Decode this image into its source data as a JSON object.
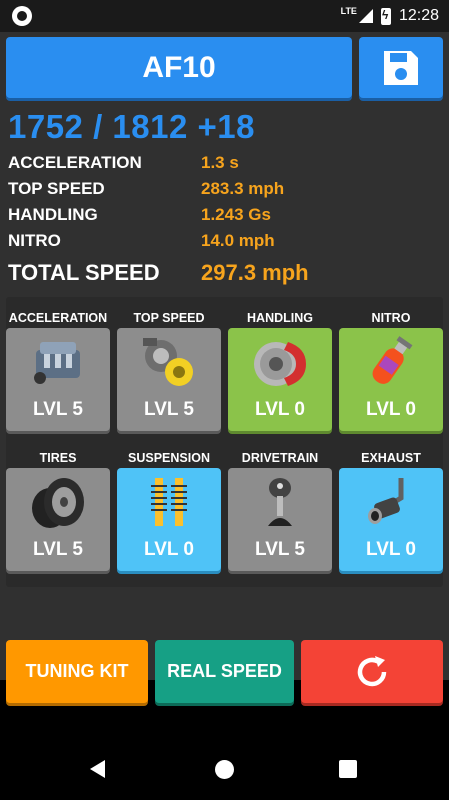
{
  "status_bar": {
    "network": "LTE",
    "time": "12:28"
  },
  "header": {
    "car_name": "AF10",
    "save_icon": "floppy-disk-icon"
  },
  "score": "1752 / 1812 +18",
  "stats": [
    {
      "label": "ACCELERATION",
      "value": "1.3 s"
    },
    {
      "label": "TOP SPEED",
      "value": "283.3 mph"
    },
    {
      "label": "HANDLING",
      "value": "1.243 Gs"
    },
    {
      "label": "NITRO",
      "value": "14.0 mph"
    }
  ],
  "total": {
    "label": "TOTAL SPEED",
    "value": "297.3 mph"
  },
  "upgrades": [
    {
      "label": "ACCELERATION",
      "level": "LVL 5",
      "color": "gray",
      "icon": "engine-icon"
    },
    {
      "label": "TOP SPEED",
      "level": "LVL 5",
      "color": "gray",
      "icon": "turbo-icon"
    },
    {
      "label": "HANDLING",
      "level": "LVL 0",
      "color": "green",
      "icon": "brake-disc-icon"
    },
    {
      "label": "NITRO",
      "level": "LVL 0",
      "color": "green",
      "icon": "nitro-bottle-icon"
    },
    {
      "label": "TIRES",
      "level": "LVL 5",
      "color": "gray",
      "icon": "tires-icon"
    },
    {
      "label": "SUSPENSION",
      "level": "LVL 0",
      "color": "blue",
      "icon": "suspension-icon"
    },
    {
      "label": "DRIVETRAIN",
      "level": "LVL 5",
      "color": "gray",
      "icon": "gear-shifter-icon"
    },
    {
      "label": "EXHAUST",
      "level": "LVL 0",
      "color": "blue",
      "icon": "exhaust-icon"
    }
  ],
  "buttons": {
    "tuning": "TUNING KIT",
    "real_speed": "REAL SPEED",
    "reset_icon": "refresh-icon"
  },
  "colors": {
    "accent_blue": "#2a8ef0",
    "value_orange": "#f7a41d",
    "green": "#8bc34a",
    "light_blue": "#4fc3f7",
    "gray": "#8d8d8d",
    "orange": "#ff9800",
    "teal": "#16a085",
    "red": "#f44336"
  }
}
